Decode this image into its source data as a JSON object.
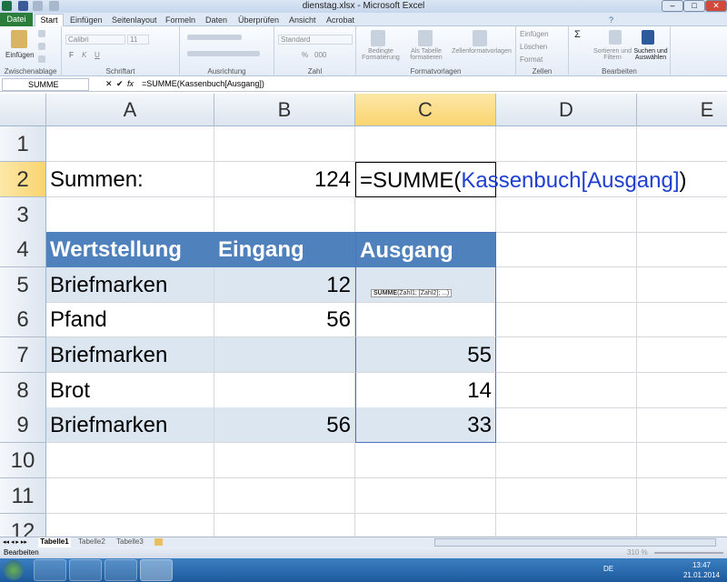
{
  "window": {
    "title": "dienstag.xlsx - Microsoft Excel",
    "min": "–",
    "max": "□",
    "close": "✕"
  },
  "tabs": {
    "file": "Datei",
    "items": [
      "Start",
      "Einfügen",
      "Seitenlayout",
      "Formeln",
      "Daten",
      "Überprüfen",
      "Ansicht",
      "Acrobat"
    ]
  },
  "ribbon": {
    "clipboard": {
      "paste": "Einfügen",
      "label": "Zwischenablage"
    },
    "font": {
      "name": "Calibri",
      "size": "11",
      "bold": "F",
      "italic": "K",
      "underline": "U",
      "label": "Schriftart"
    },
    "alignment": {
      "label": "Ausrichtung"
    },
    "number": {
      "format": "Standard",
      "label": "Zahl",
      "percent": "%",
      "thousands": "000"
    },
    "styles": {
      "conditional": "Bedingte Formatierung",
      "as_table": "Als Tabelle formatieren",
      "cell_styles": "Zellenformatvorlagen",
      "label": "Formatvorlagen"
    },
    "cells": {
      "insert": "Einfügen",
      "delete": "Löschen",
      "format": "Format",
      "label": "Zellen"
    },
    "editing": {
      "sum": "Σ",
      "sort": "Sortieren und Filtern",
      "find": "Suchen und Auswählen",
      "label": "Bearbeiten"
    }
  },
  "formula_bar": {
    "name_box": "SUMME",
    "cancel": "✕",
    "enter": "✔",
    "fx": "fx",
    "formula": "=SUMME(Kassenbuch[Ausgang])"
  },
  "columns": [
    "A",
    "B",
    "C",
    "D",
    "E"
  ],
  "rows": [
    "1",
    "2",
    "3",
    "4",
    "5",
    "6",
    "7",
    "8",
    "9",
    "10",
    "11",
    "12"
  ],
  "cells": {
    "a2": "Summen:",
    "b2": "124",
    "c2_black": "=SUMME(",
    "c2_blue": "Kassenbuch[Ausgang]",
    "c2_end": ")",
    "header": [
      "Wertstellung",
      "Eingang",
      "Ausgang"
    ],
    "table": [
      [
        "Briefmarken",
        "12",
        ""
      ],
      [
        "Pfand",
        "56",
        ""
      ],
      [
        "Briefmarken",
        "",
        "55"
      ],
      [
        "Brot",
        "",
        "14"
      ],
      [
        "Briefmarken",
        "56",
        "33"
      ]
    ]
  },
  "tooltip": {
    "fn": "SUMME",
    "args": "(Zahl1; [Zahl2]; ...)"
  },
  "sheets": [
    "Tabelle1",
    "Tabelle2",
    "Tabelle3"
  ],
  "status": {
    "mode": "Bearbeiten",
    "zoom": "310 %"
  },
  "taskbar": {
    "lang": "DE",
    "time": "13:47",
    "date": "21.01.2014"
  }
}
